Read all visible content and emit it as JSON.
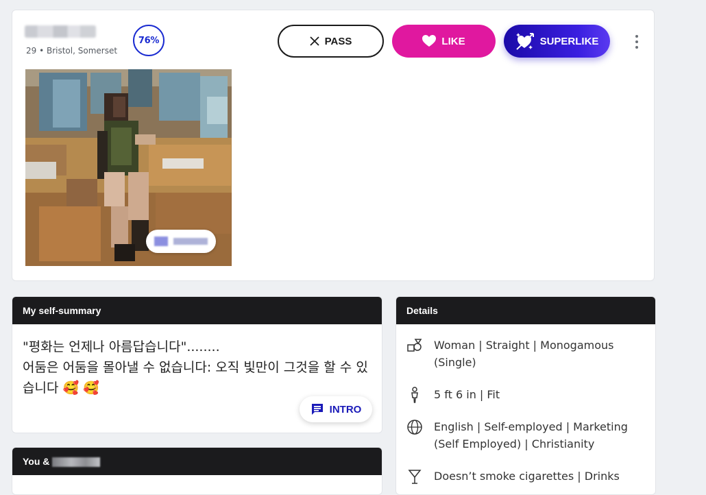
{
  "profile": {
    "meta": "29 • Bristol, Somerset",
    "match_percent": "76%"
  },
  "actions": {
    "pass": "PASS",
    "like": "LIKE",
    "superlike": "SUPERLIKE"
  },
  "summary": {
    "title": "My self-summary",
    "text": "\"평화는 언제나 아름답습니다\"........\n어둠은 어둠을 몰아낼 수 없습니다: 오직 빛만이 그것을 할 수 있습니다 🥰 🥰",
    "intro_button": "INTRO"
  },
  "details": {
    "title": "Details",
    "items": [
      {
        "icon": "gender-icon",
        "text": "Woman | Straight | Monogamous (Single)"
      },
      {
        "icon": "person-icon",
        "text": "5 ft 6 in | Fit"
      },
      {
        "icon": "globe-icon",
        "text": "English | Self-employed | Marketing (Self Employed) | Christianity"
      },
      {
        "icon": "cocktail-icon",
        "text": "Doesn’t smoke cigarettes | Drinks"
      }
    ]
  },
  "you_section": {
    "title": "You &"
  },
  "colors": {
    "like": "#e0189f",
    "superlike": "#2a14c8",
    "match": "#1a2bd1",
    "panel_header": "#1b1b1d"
  }
}
